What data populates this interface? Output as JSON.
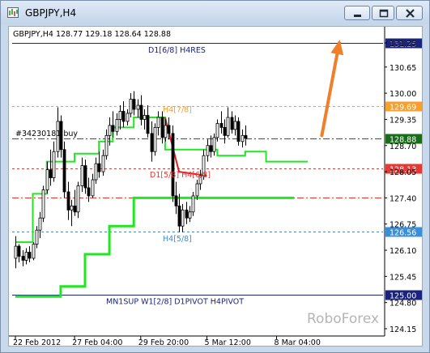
{
  "window": {
    "title": "GBPJPY,H4",
    "buttons": {
      "minimize": "minimize-icon",
      "maximize": "maximize-icon",
      "close": "close-icon"
    }
  },
  "chart_data": {
    "type": "candlestick",
    "symbol_info": "GBPJPY,H4  128.77 129.18 128.64 128.88",
    "ylim": [
      124.15,
      131.35
    ],
    "y_ticks": [
      "131.25",
      "130.65",
      "130.00",
      "129.35",
      "128.70",
      "128.05",
      "127.40",
      "126.75",
      "126.10",
      "125.45",
      "124.80",
      "124.15"
    ],
    "x_ticks": [
      "22 Feb 2012",
      "27 Feb 04:00",
      "29 Feb 20:00",
      "5 Mar 12:00",
      "8 Mar 04:00"
    ],
    "x_tick_index": [
      0,
      17,
      36,
      55,
      75
    ],
    "bars": 90,
    "candles": [
      [
        125.9,
        126.45,
        125.65,
        126.2
      ],
      [
        126.2,
        126.25,
        125.8,
        125.95
      ],
      [
        125.95,
        126.1,
        125.7,
        125.85
      ],
      [
        125.85,
        126.15,
        125.75,
        126.05
      ],
      [
        126.05,
        126.2,
        125.8,
        125.9
      ],
      [
        125.9,
        126.3,
        125.85,
        126.25
      ],
      [
        126.25,
        126.7,
        126.15,
        126.6
      ],
      [
        126.6,
        127.05,
        126.4,
        126.9
      ],
      [
        126.9,
        127.7,
        126.8,
        127.6
      ],
      [
        127.6,
        128.3,
        127.5,
        128.1
      ],
      [
        128.1,
        128.6,
        127.7,
        127.9
      ],
      [
        127.9,
        128.8,
        127.8,
        128.55
      ],
      [
        128.55,
        129.65,
        128.4,
        129.3
      ],
      [
        129.3,
        129.45,
        128.4,
        128.6
      ],
      [
        128.6,
        128.8,
        127.4,
        127.55
      ],
      [
        127.55,
        127.8,
        126.85,
        127.1
      ],
      [
        127.1,
        127.35,
        126.7,
        127.2
      ],
      [
        127.2,
        127.6,
        126.95,
        127.05
      ],
      [
        127.05,
        127.8,
        126.9,
        127.7
      ],
      [
        127.7,
        128.4,
        127.55,
        128.2
      ],
      [
        128.2,
        128.35,
        127.5,
        127.65
      ],
      [
        127.65,
        127.9,
        127.3,
        127.45
      ],
      [
        127.45,
        128.0,
        127.4,
        127.85
      ],
      [
        127.85,
        128.4,
        127.75,
        128.25
      ],
      [
        128.25,
        128.55,
        127.9,
        128.05
      ],
      [
        128.05,
        128.6,
        127.95,
        128.45
      ],
      [
        128.45,
        129.1,
        128.35,
        128.95
      ],
      [
        128.95,
        129.4,
        128.7,
        129.2
      ],
      [
        129.2,
        129.55,
        128.9,
        129.05
      ],
      [
        129.05,
        129.5,
        128.95,
        129.35
      ],
      [
        129.35,
        129.7,
        129.1,
        129.55
      ],
      [
        129.55,
        129.8,
        129.15,
        129.3
      ],
      [
        129.3,
        129.6,
        129.2,
        129.5
      ],
      [
        129.5,
        130.0,
        129.4,
        129.85
      ],
      [
        129.85,
        130.05,
        129.45,
        129.6
      ],
      [
        129.6,
        129.85,
        129.4,
        129.7
      ],
      [
        129.7,
        129.95,
        129.2,
        129.35
      ],
      [
        129.35,
        129.6,
        129.1,
        129.45
      ],
      [
        129.45,
        129.7,
        128.9,
        129.0
      ],
      [
        129.0,
        129.3,
        128.3,
        128.55
      ],
      [
        128.55,
        129.25,
        128.45,
        129.15
      ],
      [
        129.15,
        129.55,
        128.95,
        129.4
      ],
      [
        129.4,
        129.55,
        128.75,
        128.9
      ],
      [
        128.9,
        129.35,
        128.8,
        129.2
      ],
      [
        129.2,
        129.4,
        128.85,
        129.0
      ],
      [
        129.0,
        129.2,
        127.3,
        127.45
      ],
      [
        127.45,
        127.8,
        127.0,
        127.2
      ],
      [
        127.2,
        127.5,
        126.55,
        126.7
      ],
      [
        126.7,
        127.25,
        126.55,
        127.1
      ],
      [
        127.1,
        127.3,
        126.75,
        126.9
      ],
      [
        126.9,
        127.2,
        126.8,
        127.05
      ],
      [
        127.05,
        127.55,
        126.95,
        127.45
      ],
      [
        127.45,
        127.85,
        127.35,
        127.75
      ],
      [
        127.75,
        128.1,
        127.6,
        127.95
      ],
      [
        127.95,
        128.6,
        127.85,
        128.45
      ],
      [
        128.45,
        128.85,
        128.3,
        128.7
      ],
      [
        128.7,
        128.95,
        128.4,
        128.55
      ],
      [
        128.55,
        129.0,
        128.45,
        128.9
      ],
      [
        128.9,
        129.35,
        128.8,
        129.25
      ],
      [
        129.25,
        129.55,
        129.0,
        129.15
      ],
      [
        129.15,
        129.35,
        128.75,
        128.95
      ],
      [
        128.95,
        129.65,
        128.9,
        129.4
      ],
      [
        129.4,
        129.55,
        129.0,
        129.1
      ],
      [
        129.1,
        129.45,
        128.95,
        129.3
      ],
      [
        129.3,
        129.4,
        128.7,
        128.8
      ],
      [
        128.8,
        129.1,
        128.65,
        128.95
      ],
      [
        128.95,
        129.2,
        128.7,
        128.88
      ]
    ],
    "indicators": {
      "green_stepped": [
        [
          0,
          124.95
        ],
        [
          13,
          124.95
        ],
        [
          13,
          125.2
        ],
        [
          20,
          125.2
        ],
        [
          20,
          126.0
        ],
        [
          27,
          126.0
        ],
        [
          27,
          126.7
        ],
        [
          34,
          126.7
        ],
        [
          34,
          127.4
        ],
        [
          80,
          127.4
        ]
      ],
      "green_thin": [
        [
          0,
          126.3
        ],
        [
          5,
          126.3
        ],
        [
          5,
          127.5
        ],
        [
          9,
          127.5
        ],
        [
          9,
          128.3
        ],
        [
          17,
          128.3
        ],
        [
          17,
          128.5
        ],
        [
          24,
          128.5
        ],
        [
          24,
          128.8
        ],
        [
          28,
          128.8
        ],
        [
          28,
          129.15
        ],
        [
          34,
          129.15
        ],
        [
          34,
          129.4
        ],
        [
          43,
          129.4
        ],
        [
          43,
          128.6
        ],
        [
          58,
          128.6
        ],
        [
          58,
          128.45
        ],
        [
          66,
          128.45
        ],
        [
          66,
          128.55
        ],
        [
          72,
          128.55
        ],
        [
          72,
          128.3
        ],
        [
          84,
          128.3
        ]
      ],
      "red_segment": [
        [
          43,
          129.4
        ],
        [
          47,
          128.05
        ],
        [
          55,
          127.95
        ]
      ]
    },
    "levels": [
      {
        "price": 131.25,
        "label": "D1[6/8] H4RES",
        "color": "#1a237e",
        "style": "solid",
        "tag": "131.25"
      },
      {
        "price": 129.69,
        "label": "H4[7/8]",
        "color": "#f5a031",
        "style": "dashed",
        "tag": "129.69"
      },
      {
        "price": 128.88,
        "label": "#34230181 buy",
        "color": "#1a6b1a",
        "style": "dashdot",
        "tag": "128.88"
      },
      {
        "price": 128.13,
        "label": "D1[5/8] H4[6/8]",
        "color": "#e53935",
        "style": "dashed",
        "tag": "128.13"
      },
      {
        "price": 127.4,
        "label": "",
        "color": "#e53935",
        "style": "dashdot",
        "tag": ""
      },
      {
        "price": 126.56,
        "label": "H4[5/8]",
        "color": "#3a8fd8",
        "style": "dashed",
        "tag": "126.56"
      },
      {
        "price": 125.0,
        "label": "MN1SUP W1[2/8] D1PIVOT H4PIVOT",
        "color": "#1a237e",
        "style": "solid",
        "tag": "125.00"
      }
    ],
    "arrow": {
      "from_bar": 88,
      "from_price": 128.95,
      "to_bar": 93,
      "to_price": 131.25,
      "color": "#f07f2a"
    },
    "watermark": "RoboForex"
  }
}
